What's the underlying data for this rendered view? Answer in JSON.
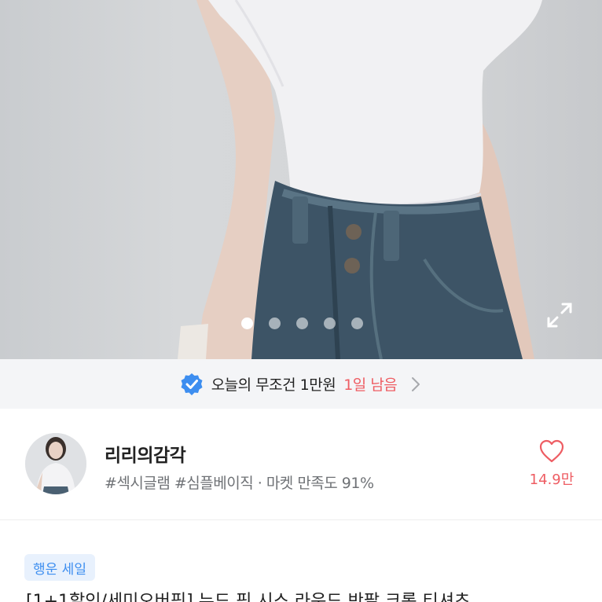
{
  "hero": {
    "dots_total": 5,
    "active_index": 0,
    "expand_icon": "expand-icon"
  },
  "promo": {
    "icon": "verified-check-icon",
    "label": "오늘의 무조건 1만원",
    "remaining": "1일 남음",
    "chevron_icon": "chevron-right-icon",
    "accent": "#ee5d63",
    "check_color": "#3d8ef0"
  },
  "shop": {
    "name": "리리의감각",
    "tags": "#섹시글램 #심플베이직 · 마켓 만족도 91%",
    "like_count": "14.9만",
    "like_icon": "heart-outline-icon"
  },
  "badge": {
    "label": "행운 세일"
  },
  "product": {
    "title_partial": "[1+1할인/세미오버핏] 누드 핏 시스 라운드 반팔 크롭 티셔츠"
  }
}
